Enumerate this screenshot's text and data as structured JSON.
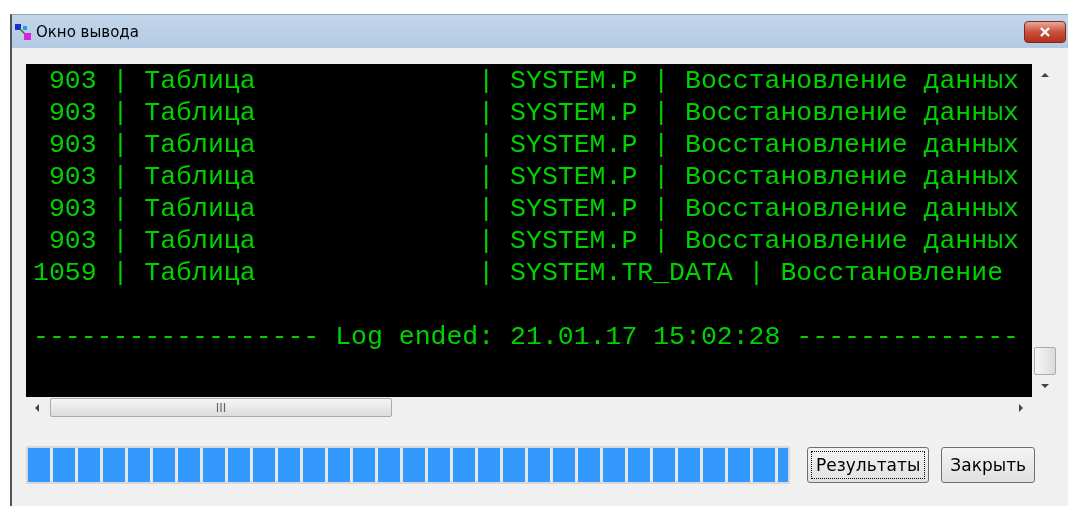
{
  "window": {
    "title": "Окно вывода"
  },
  "console": {
    "lines": [
      {
        "kind": "record",
        "text": " 903 | Таблица              | SYSTEM.P | Восстановление данных"
      },
      {
        "kind": "record",
        "text": " 903 | Таблица              | SYSTEM.P | Восстановление данных"
      },
      {
        "kind": "record",
        "text": " 903 | Таблица              | SYSTEM.P | Восстановление данных"
      },
      {
        "kind": "record",
        "text": " 903 | Таблица              | SYSTEM.P | Восстановление данных"
      },
      {
        "kind": "record",
        "text": " 903 | Таблица              | SYSTEM.P | Восстановление данных"
      },
      {
        "kind": "record",
        "text": " 903 | Таблица              | SYSTEM.P | Восстановление данных"
      },
      {
        "kind": "record",
        "text": "1059 | Таблица              | SYSTEM.TR_DATA | Восстановление"
      },
      {
        "kind": "footer",
        "text": "------------------ Log ended: 21.01.17 15:02:28 --------------"
      }
    ]
  },
  "progress": {
    "level": 1
  },
  "buttons": [
    {
      "label": "Результаты",
      "focused": true
    },
    {
      "label": "Закрыть",
      "focused": false
    }
  ]
}
